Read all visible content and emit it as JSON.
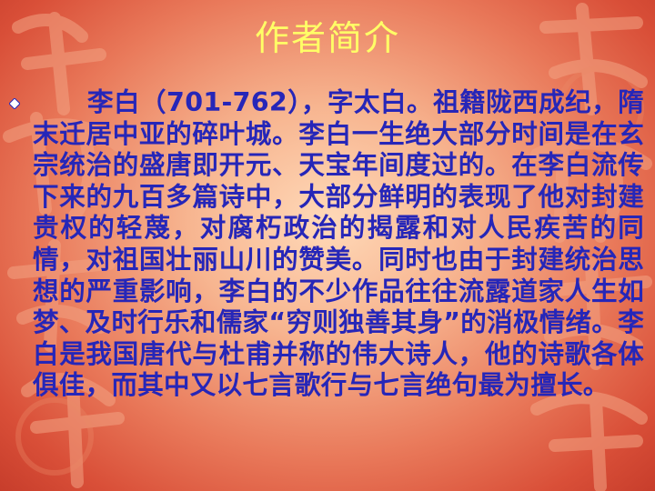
{
  "slide": {
    "title": "作者简介",
    "bullet_icon": "diamond-bullet-icon",
    "paragraph": "李白（701-762），字太白。祖籍陇西成纪，隋末迁居中亚的碎叶城。李白一生绝大部分时间是在玄宗统治的盛唐即开元、天宝年间度过的。在李白流传下来的九百多篇诗中，大部分鲜明的表现了他对封建贵权的轻蔑，对腐朽政治的揭露和对人民疾苦的同情，对祖国壮丽山川的赞美。同时也由于封建统治思想的严重影响，李白的不少作品往往流露道家人生如梦、及时行乐和儒家“穷则独善其身”的消极情绪。李白是我国唐代与杜甫并称的伟大诗人，他的诗歌各体俱佳，而其中又以七言歌行与七言绝句最为擅长。"
  },
  "colors": {
    "title": "#ffff66",
    "body_text": "#2626b8",
    "background_center": "#ffd9b8",
    "background_edge": "#c73d2b"
  }
}
